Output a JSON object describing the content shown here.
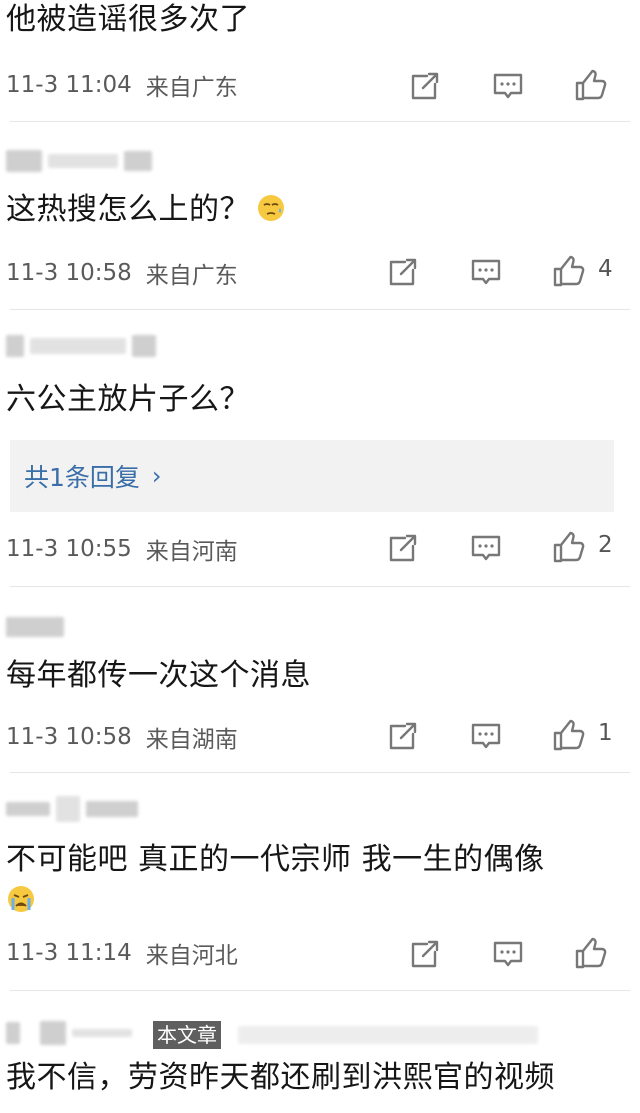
{
  "comments": [
    {
      "username": "",
      "text": "他被造谣很多次了",
      "time": "11-3 11:04",
      "location": "来自广东",
      "likes": ""
    },
    {
      "username": "",
      "text": "这热搜怎么上的？",
      "emoji": "sweat-emoji",
      "time": "11-3 10:58",
      "location": "来自广东",
      "likes": "4"
    },
    {
      "username": "",
      "text": "六公主放片子么？",
      "replies": "共1条回复",
      "time": "11-3 10:55",
      "location": "来自河南",
      "likes": "2"
    },
    {
      "username": "",
      "text": "每年都传一次这个消息",
      "time": "11-3 10:58",
      "location": "来自湖南",
      "likes": "1"
    },
    {
      "username": "",
      "text": "不可能吧  真正的一代宗师  我一生的偶像",
      "emoji": "crying-emoji",
      "time": "11-3 11:14",
      "location": "来自河北",
      "likes": ""
    },
    {
      "username": "",
      "text": "我不信，劳资昨天都还刷到洪熙官的视频"
    }
  ],
  "watermark": "本文章",
  "colors": {
    "reply_link": "#3a6ea8",
    "reply_bg": "#f2f2f2",
    "divider": "#e6e6e6",
    "meta": "#5a5a5a"
  }
}
